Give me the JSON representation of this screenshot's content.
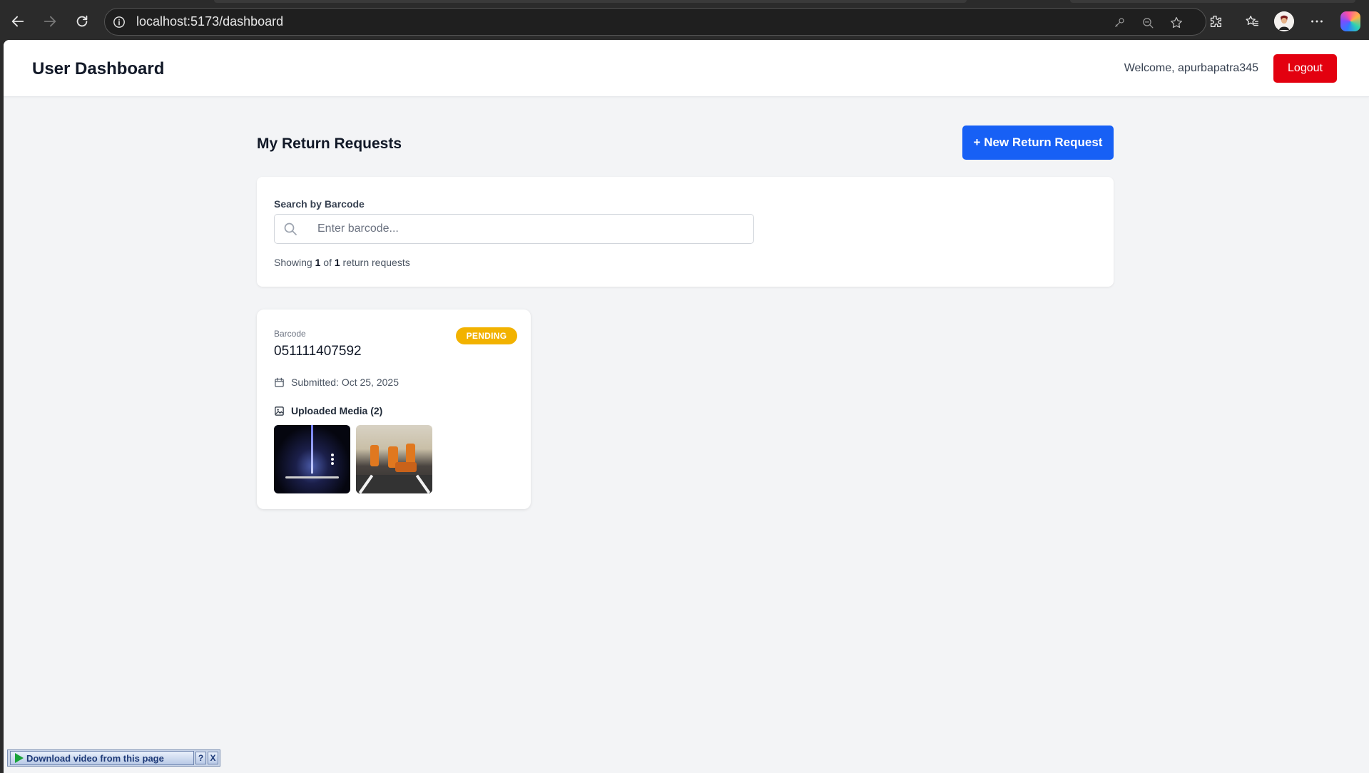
{
  "browser": {
    "url": "localhost:5173/dashboard"
  },
  "header": {
    "title": "User Dashboard",
    "welcome": "Welcome, apurbapatra345",
    "logout_label": "Logout"
  },
  "main": {
    "section_title": "My Return Requests",
    "new_request_label": "+ New Return Request",
    "search": {
      "label": "Search by Barcode",
      "placeholder": "Enter barcode...",
      "showing_prefix": "Showing ",
      "shown_count": "1",
      "showing_mid": " of ",
      "total_count": "1",
      "showing_suffix": " return requests"
    },
    "requests": [
      {
        "barcode_label": "Barcode",
        "barcode": "051111407592",
        "status": "PENDING",
        "submitted": "Submitted: Oct 25, 2025",
        "media_label": "Uploaded Media (2)"
      }
    ]
  },
  "extension": {
    "download_label": "Download video from this page",
    "help_label": "?",
    "close_label": "X"
  },
  "colors": {
    "logout": "#e3000f",
    "primary": "#1760f5",
    "pending": "#f2b200",
    "page_bg": "#f3f4f6"
  }
}
